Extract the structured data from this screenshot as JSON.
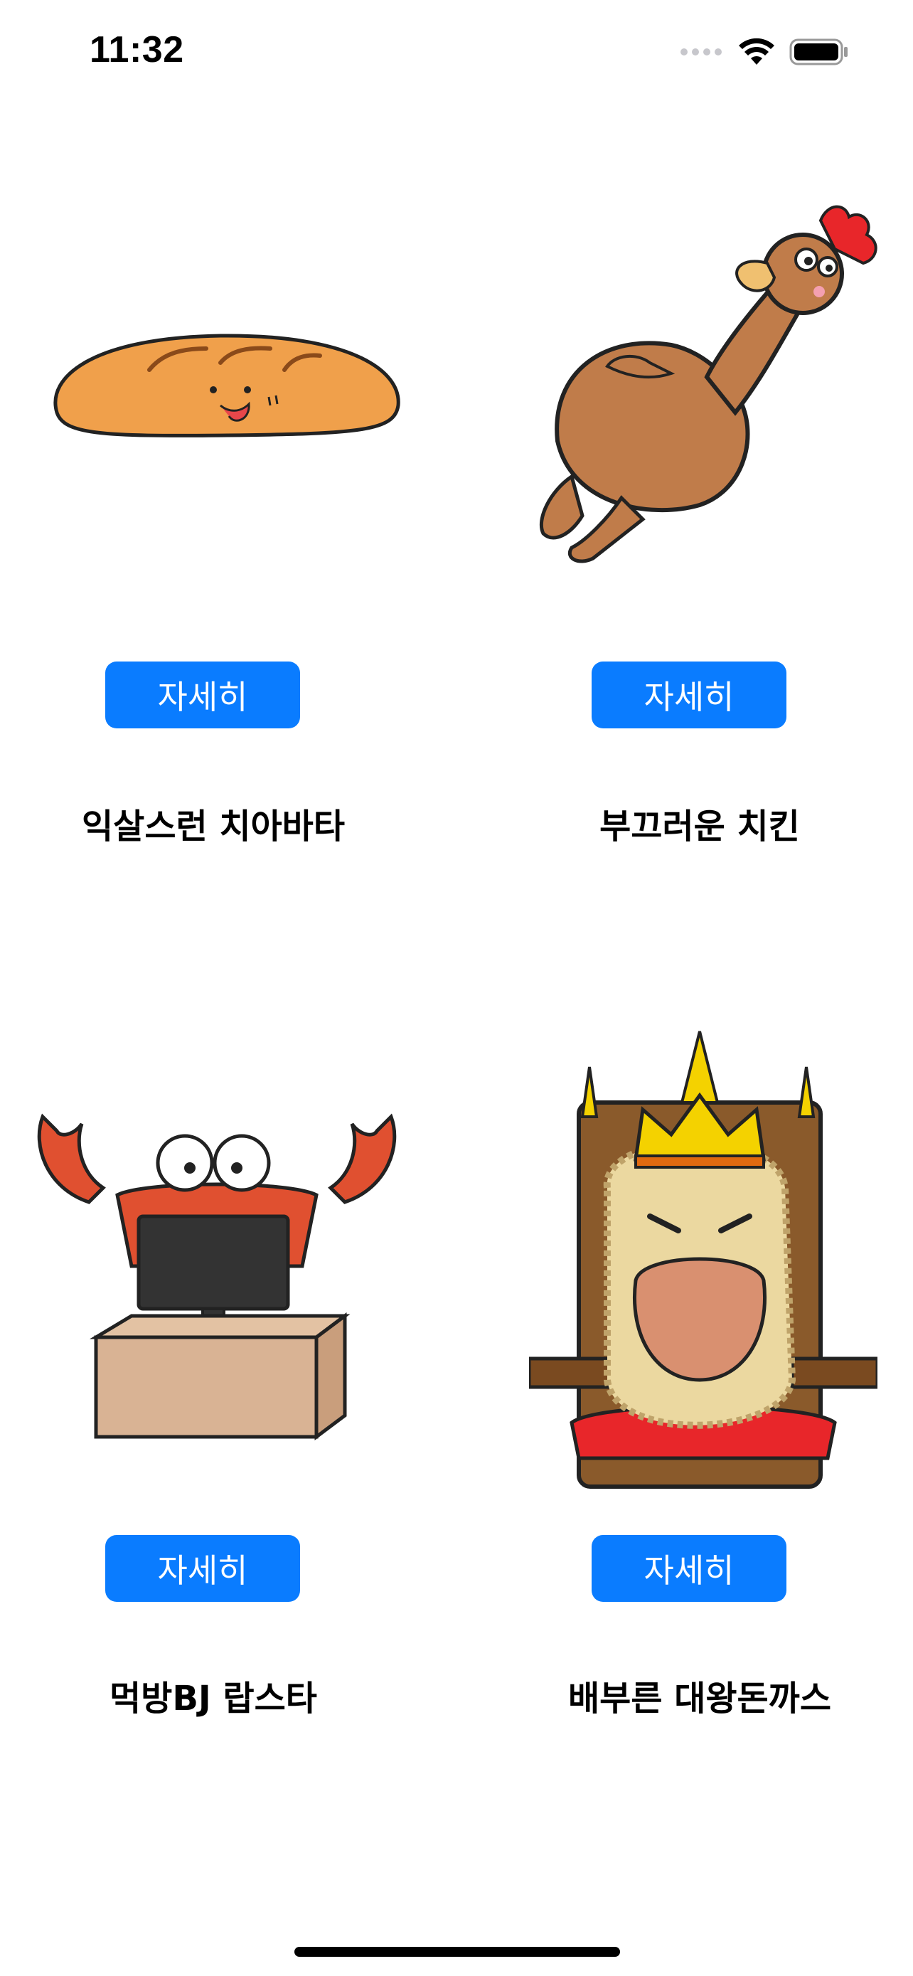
{
  "status_bar": {
    "time": "11:32",
    "icons": [
      "signal-dots-icon",
      "wifi-icon",
      "battery-icon"
    ]
  },
  "theme": {
    "button_color": "#0a7cff",
    "button_text_color": "#ffffff"
  },
  "items": [
    {
      "title": "익살스런 치아바타",
      "button_label": "자세히",
      "illustration": "ciabatta-bread-illustration"
    },
    {
      "title": "부끄러운 치킨",
      "button_label": "자세히",
      "illustration": "shy-chicken-illustration"
    },
    {
      "title": "먹방BJ 랍스타",
      "button_label": "자세히",
      "illustration": "lobster-bj-illustration"
    },
    {
      "title": "배부른 대왕돈까스",
      "button_label": "자세히",
      "illustration": "king-pork-cutlet-illustration"
    }
  ]
}
